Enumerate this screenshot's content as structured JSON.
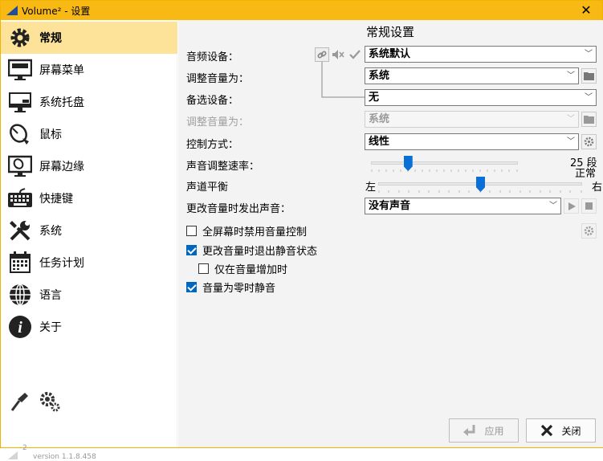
{
  "window": {
    "title": "Volume² - 设置"
  },
  "sidebar": {
    "items": [
      {
        "label": "常规",
        "icon": "gear-icon",
        "active": true
      },
      {
        "label": "屏幕菜单",
        "icon": "monitor-menu-icon"
      },
      {
        "label": "系统托盘",
        "icon": "monitor-tray-icon"
      },
      {
        "label": "鼠标",
        "icon": "mouse-icon"
      },
      {
        "label": "屏幕边缘",
        "icon": "monitor-edge-icon"
      },
      {
        "label": "快捷键",
        "icon": "keyboard-icon"
      },
      {
        "label": "系统",
        "icon": "tools-icon"
      },
      {
        "label": "任务计划",
        "icon": "calendar-icon"
      },
      {
        "label": "语言",
        "icon": "globe-icon"
      },
      {
        "label": "关于",
        "icon": "info-icon"
      }
    ],
    "version_num": "2",
    "version_text": "version 1.1.8.458"
  },
  "main": {
    "title": "常规设置",
    "audio_device": {
      "label": "音频设备：",
      "value": "系统默认"
    },
    "adjust_for": {
      "label": "调整音量为：",
      "value": "系统"
    },
    "alt_device": {
      "label": "备选设备：",
      "value": "无"
    },
    "alt_adjust_for": {
      "label": "调整音量为：",
      "value": "系统"
    },
    "control_mode": {
      "label": "控制方式：",
      "value": "线性"
    },
    "speed": {
      "label": "声音调整速率：",
      "right_label_1": "25 段",
      "right_label_2": "正常",
      "level": 0.25
    },
    "balance": {
      "label": "声道平衡",
      "left": "左",
      "right": "右",
      "level": 0.5
    },
    "change_sound": {
      "label": "更改音量时发出声音：",
      "value": "没有声音"
    },
    "options": [
      {
        "label": "全屏幕时禁用音量控制",
        "checked": false
      },
      {
        "label": "更改音量时退出静音状态",
        "checked": true
      },
      {
        "label": "仅在音量增加时",
        "checked": false
      },
      {
        "label": "音量为零时静音",
        "checked": true
      }
    ]
  },
  "footer": {
    "apply": "应用",
    "close": "关闭"
  }
}
